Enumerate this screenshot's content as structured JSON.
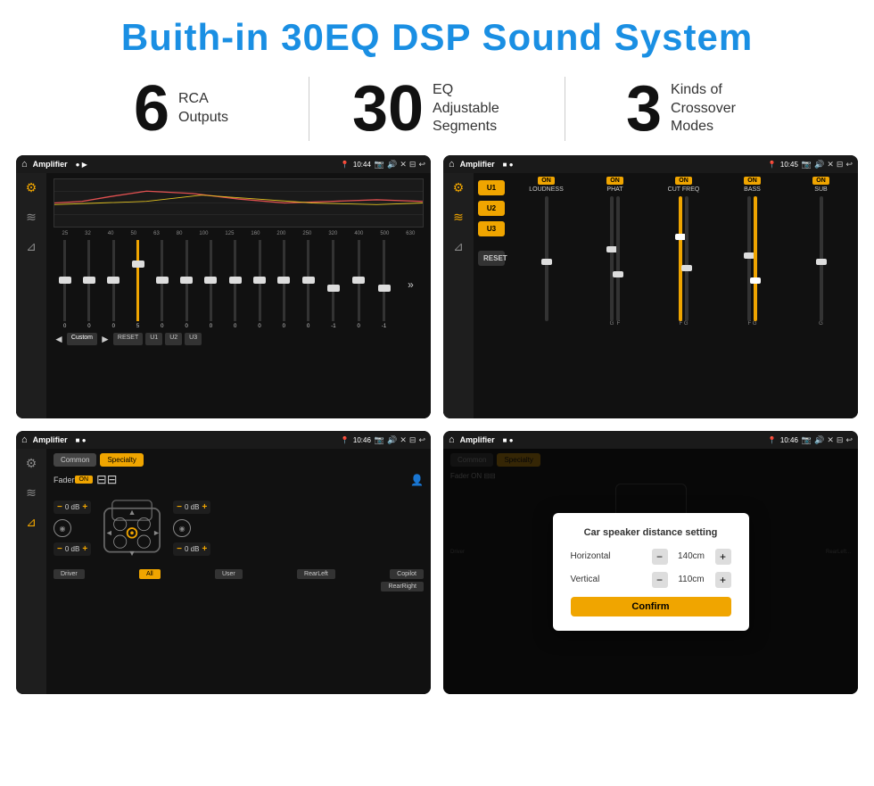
{
  "header": {
    "title": "Buith-in 30EQ DSP Sound System"
  },
  "stats": [
    {
      "number": "6",
      "label": "RCA\nOutputs"
    },
    {
      "number": "30",
      "label": "EQ Adjustable\nSegments"
    },
    {
      "number": "3",
      "label": "Kinds of\nCrossover Modes"
    }
  ],
  "screens": [
    {
      "id": "screen1",
      "title": "Amplifier",
      "time": "10:44",
      "type": "eq"
    },
    {
      "id": "screen2",
      "title": "Amplifier",
      "time": "10:45",
      "type": "crossover"
    },
    {
      "id": "screen3",
      "title": "Amplifier",
      "time": "10:46",
      "type": "fader"
    },
    {
      "id": "screen4",
      "title": "Amplifier",
      "time": "10:46",
      "type": "distance"
    }
  ],
  "eq": {
    "frequencies": [
      "25",
      "32",
      "40",
      "50",
      "63",
      "80",
      "100",
      "125",
      "160",
      "200",
      "250",
      "320",
      "400",
      "500",
      "630"
    ],
    "values": [
      "0",
      "0",
      "0",
      "5",
      "0",
      "0",
      "0",
      "0",
      "0",
      "0",
      "0",
      "-1",
      "0",
      "-1"
    ],
    "buttons": [
      "Custom",
      "RESET",
      "U1",
      "U2",
      "U3"
    ]
  },
  "crossover": {
    "channels": [
      "LOUDNESS",
      "PHAT",
      "CUT FREQ",
      "BASS",
      "SUB"
    ],
    "uButtons": [
      "U1",
      "U2",
      "U3"
    ],
    "resetLabel": "RESET"
  },
  "fader": {
    "tabs": [
      "Common",
      "Specialty"
    ],
    "faderLabel": "Fader",
    "onLabel": "ON",
    "dbValues": [
      "0 dB",
      "0 dB",
      "0 dB",
      "0 dB"
    ],
    "bottomButtons": [
      "Driver",
      "All",
      "User",
      "RearLeft",
      "RearRight",
      "Copilot"
    ]
  },
  "dialog": {
    "title": "Car speaker distance setting",
    "horizontal": {
      "label": "Horizontal",
      "value": "140cm"
    },
    "vertical": {
      "label": "Vertical",
      "value": "110cm"
    },
    "confirm": "Confirm"
  }
}
